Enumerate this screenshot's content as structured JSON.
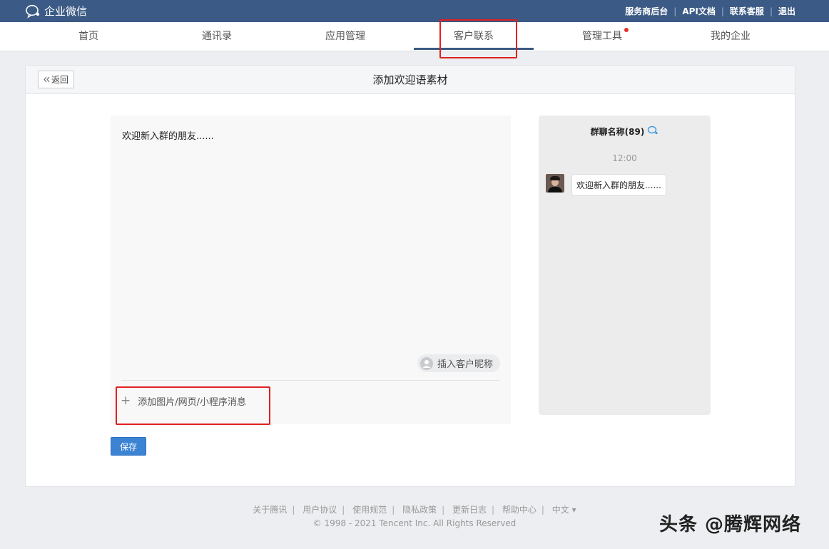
{
  "topbar": {
    "logo_text": "企业微信",
    "links": [
      "服务商后台",
      "API文档",
      "联系客服",
      "退出"
    ]
  },
  "nav": {
    "items": [
      "首页",
      "通讯录",
      "应用管理",
      "客户联系",
      "管理工具",
      "我的企业"
    ],
    "active": "客户联系"
  },
  "page": {
    "back_label": "返回",
    "title": "添加欢迎语素材"
  },
  "editor": {
    "text": "欢迎新入群的朋友......",
    "insert_nickname_label": "插入客户昵称",
    "add_media_label": "添加图片/网页/小程序消息"
  },
  "preview": {
    "group_name": "群聊名称(89)",
    "time": "12:00",
    "message": "欢迎新入群的朋友......"
  },
  "actions": {
    "save_label": "保存"
  },
  "footer": {
    "links": [
      "关于腾讯",
      "用户协议",
      "使用规范",
      "隐私政策",
      "更新日志",
      "帮助中心"
    ],
    "language": "中文",
    "copyright": "© 1998 - 2021 Tencent Inc. All Rights Reserved"
  },
  "watermark": "头条 @腾辉网络",
  "colors": {
    "topbar": "#3b5a85",
    "accent_blue": "#3c83d4",
    "highlight_red": "#e02020"
  }
}
